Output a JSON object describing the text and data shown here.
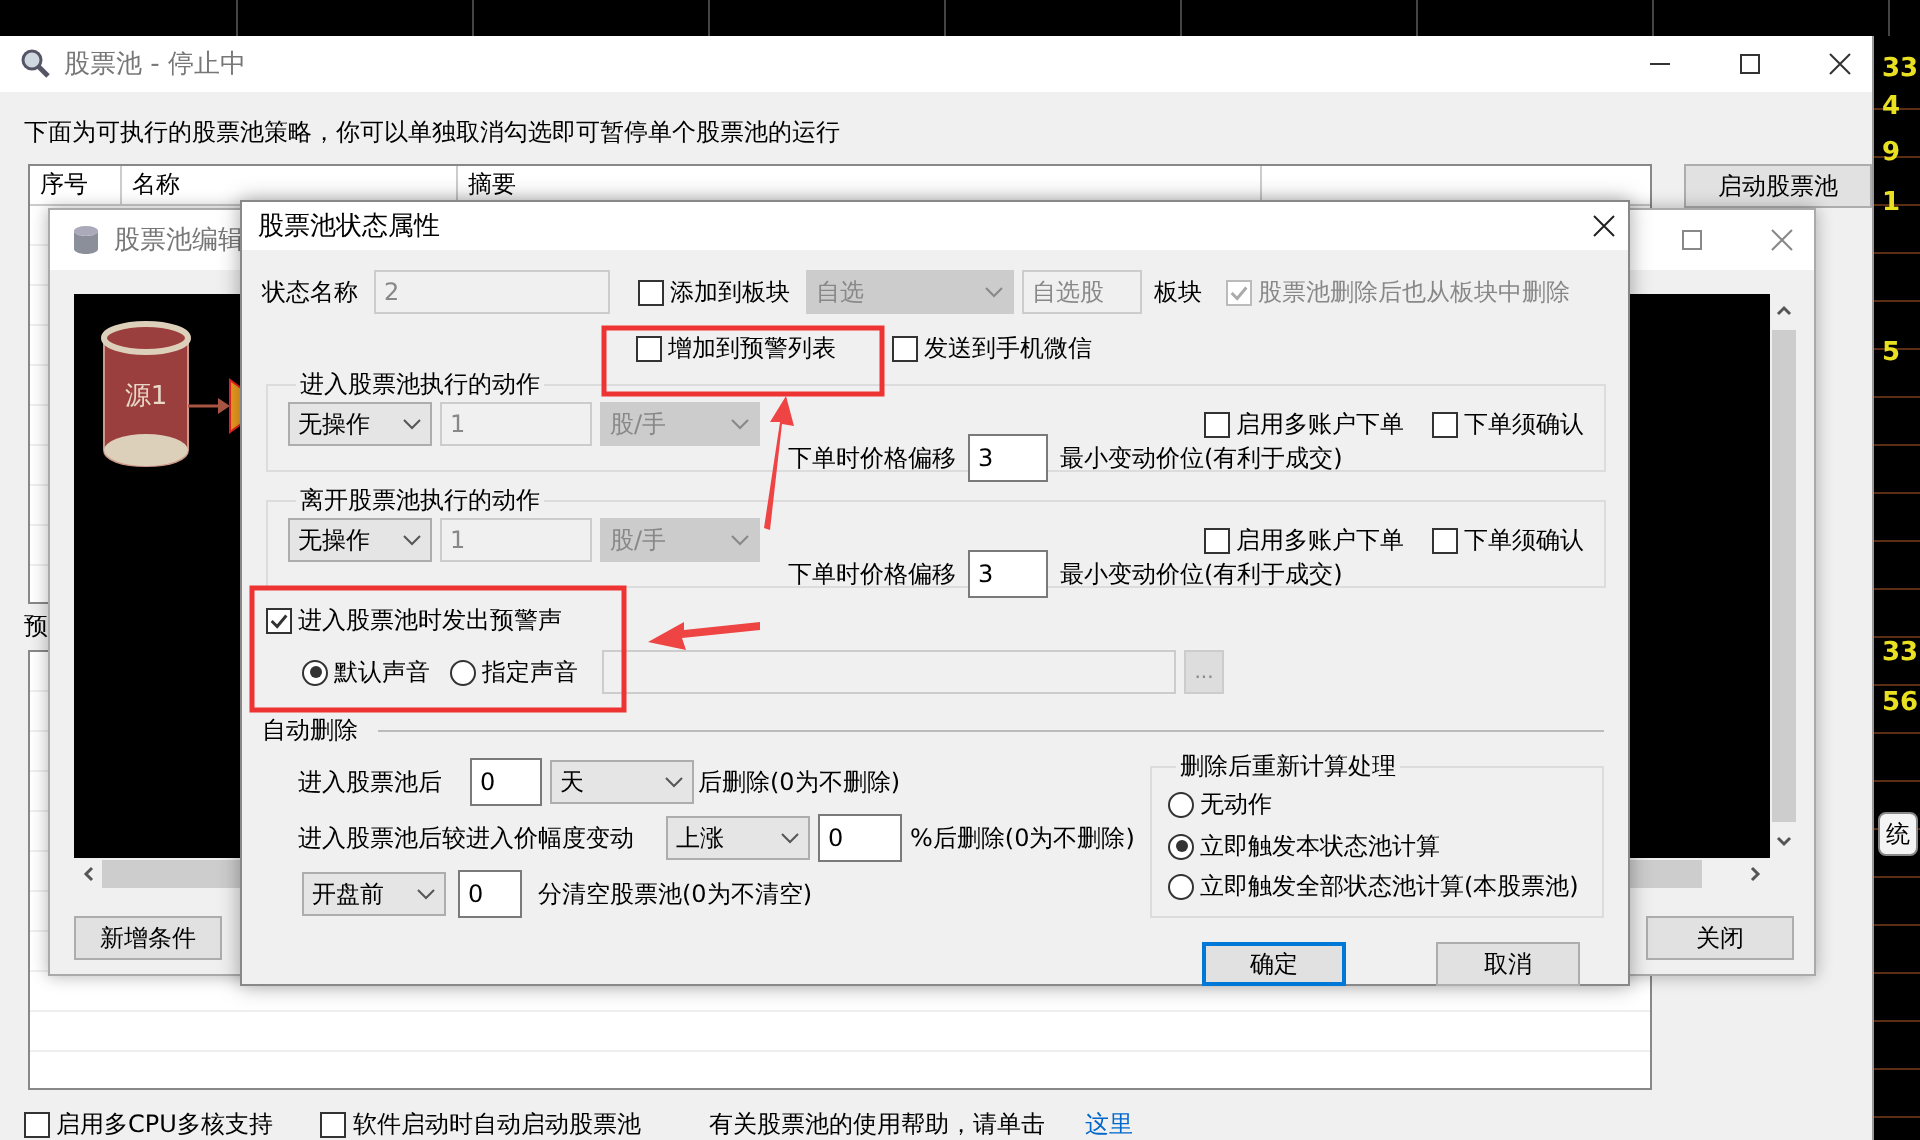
{
  "market_strip": {
    "right_values": [
      "33",
      "4",
      "9",
      "1",
      "5",
      "33",
      "56"
    ],
    "stat_button": "统"
  },
  "main_window": {
    "title": "股票池  -  停止中",
    "instruction": "下面为可执行的股票池策略，你可以单独取消勾选即可暂停单个股票池的运行",
    "columns": [
      "序号",
      "名称",
      "摘要"
    ],
    "start_button": "启动股票池",
    "side_label": "预",
    "bottom_options": [
      {
        "label": "启用多CPU多核支持",
        "checked": false
      },
      {
        "label": "软件启动时自动启动股票池",
        "checked": false
      }
    ],
    "help_text": "有关股票池的使用帮助，请单击",
    "help_link": "这里"
  },
  "editor_window": {
    "title": "股票池编辑",
    "node_label": "源1",
    "add_button": "新增条件",
    "close_button": "关闭"
  },
  "dialog": {
    "title": "股票池状态属性",
    "name_label": "状态名称",
    "name_value": {
      "value": "2",
      "disabled": true
    },
    "add_to_block": {
      "label": "添加到板块",
      "checked": false,
      "disabled": false
    },
    "block_select": {
      "value": "自选",
      "disabled": true
    },
    "block_name": {
      "value": "自选股",
      "disabled": true
    },
    "block_label": "板块",
    "delete_with_pool": {
      "label": "股票池删除后也从板块中删除",
      "checked": true,
      "disabled": true
    },
    "add_to_alert": {
      "label": "增加到预警列表",
      "checked": false,
      "disabled": false
    },
    "send_wechat": {
      "label": "发送到手机微信",
      "checked": false,
      "disabled": false
    },
    "action_groups": [
      {
        "title": "进入股票池执行的动作",
        "action": {
          "value": "无操作",
          "disabled": false
        },
        "quantity": {
          "value": "1",
          "disabled": true
        },
        "unit": {
          "value": "股/手",
          "disabled": true
        },
        "options": [
          {
            "label": "启用多账户下单",
            "checked": false,
            "disabled": false
          },
          {
            "label": "下单须确认",
            "checked": false,
            "disabled": false
          }
        ],
        "offset_label": "下单时价格偏移",
        "offset": {
          "value": "3",
          "disabled": false
        },
        "offset_unit": "最小变动价位(有利于成交)"
      },
      {
        "title": "离开股票池执行的动作",
        "action": {
          "value": "无操作",
          "disabled": false
        },
        "quantity": {
          "value": "1",
          "disabled": true
        },
        "unit": {
          "value": "股/手",
          "disabled": true
        },
        "options": [
          {
            "label": "启用多账户下单",
            "checked": false,
            "disabled": false
          },
          {
            "label": "下单须确认",
            "checked": false,
            "disabled": false
          }
        ],
        "offset_label": "下单时价格偏移",
        "offset": {
          "value": "3",
          "disabled": false
        },
        "offset_unit": "最小变动价位(有利于成交)"
      }
    ],
    "alert_sound": {
      "label": "进入股票池时发出预警声",
      "checked": true,
      "disabled": false,
      "choices": [
        {
          "label": "默认声音",
          "selected": true
        },
        {
          "label": "指定声音",
          "selected": false
        }
      ],
      "path": {
        "disabled": true
      },
      "browse": "..."
    },
    "auto_delete": {
      "title": "自动删除",
      "days_label": "进入股票池后",
      "days": {
        "value": "0",
        "disabled": false
      },
      "days_unit": {
        "value": "天",
        "disabled": false
      },
      "days_suffix": "后删除(0为不删除)",
      "change_label": "进入股票池后较进入价幅度变动",
      "direction": {
        "value": "上涨",
        "disabled": false
      },
      "change": {
        "value": "0",
        "disabled": false
      },
      "change_suffix": "%后删除(0为不删除)",
      "clear_when": {
        "value": "开盘前",
        "disabled": false
      },
      "clear_minutes": {
        "value": "0",
        "disabled": false
      },
      "clear_suffix": "分清空股票池(0为不清空)"
    },
    "recalc": {
      "title": "删除后重新计算处理",
      "choices": [
        {
          "label": "无动作",
          "selected": false
        },
        {
          "label": "立即触发本状态池计算",
          "selected": true
        },
        {
          "label": "立即触发全部状态池计算(本股票池)",
          "selected": false
        }
      ]
    },
    "ok_button": "确定",
    "cancel_button": "取消"
  }
}
